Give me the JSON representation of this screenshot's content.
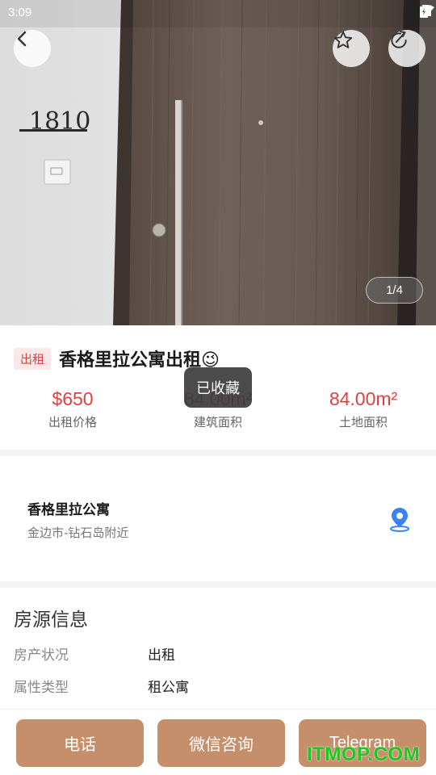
{
  "status_bar": {
    "time": "3:09"
  },
  "gallery": {
    "counter": "1/4",
    "room_number": "1810"
  },
  "listing": {
    "tag": "出租",
    "title": "香格里拉公寓出租😉",
    "stats": [
      {
        "value": "$650",
        "label": "出租价格"
      },
      {
        "value": "84.00m²",
        "label": "建筑面积"
      },
      {
        "value": "84.00m²",
        "label": "土地面积"
      }
    ]
  },
  "toast": {
    "text": "已收藏"
  },
  "location": {
    "name": "香格里拉公寓",
    "address": "金边市-钻石岛附近"
  },
  "info": {
    "title": "房源信息",
    "rows": [
      {
        "key": "房产状况",
        "value": "出租"
      },
      {
        "key": "属性类型",
        "value": "租公寓"
      }
    ]
  },
  "actions": {
    "phone": "电话",
    "wechat": "微信咨询",
    "telegram": "Telegram"
  },
  "watermark": "ITMOP.COM",
  "colors": {
    "accent_red": "#e0413e",
    "button_brown": "#c48f6a",
    "map_blue": "#3b82f6"
  }
}
